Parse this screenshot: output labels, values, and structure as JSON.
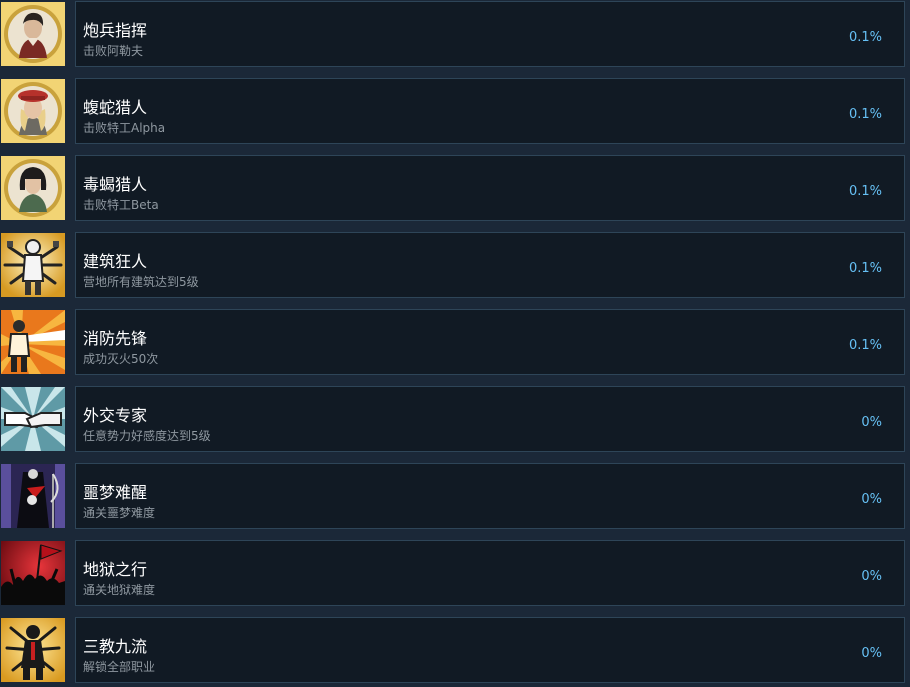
{
  "achievements": [
    {
      "title": "炮兵指挥",
      "description": "击败阿勒夫",
      "percent": "0.1%",
      "icon": "soldier-portrait-icon"
    },
    {
      "title": "蝮蛇猎人",
      "description": "击败特工Alpha",
      "percent": "0.1%",
      "icon": "red-beret-woman-portrait-icon"
    },
    {
      "title": "毒蝎猎人",
      "description": "击败特工Beta",
      "percent": "0.1%",
      "icon": "bob-hair-woman-portrait-icon"
    },
    {
      "title": "建筑狂人",
      "description": "营地所有建筑达到5级",
      "percent": "0.1%",
      "icon": "multi-arm-builder-icon"
    },
    {
      "title": "消防先锋",
      "description": "成功灭火50次",
      "percent": "0.1%",
      "icon": "firefighter-hose-icon"
    },
    {
      "title": "外交专家",
      "description": "任意势力好感度达到5级",
      "percent": "0%",
      "icon": "handshake-icon"
    },
    {
      "title": "噩梦难醒",
      "description": "通关噩梦难度",
      "percent": "0%",
      "icon": "grim-reaper-icon"
    },
    {
      "title": "地狱之行",
      "description": "通关地狱难度",
      "percent": "0%",
      "icon": "crowd-red-flag-icon"
    },
    {
      "title": "三教九流",
      "description": "解锁全部职业",
      "percent": "0%",
      "icon": "many-hands-figure-icon"
    }
  ],
  "colors": {
    "background": "#1b2838",
    "panel": "#111a24",
    "panel_border": "#2e4558",
    "title": "#ffffff",
    "description": "#8f98a0",
    "percent": "#66c0f4"
  }
}
